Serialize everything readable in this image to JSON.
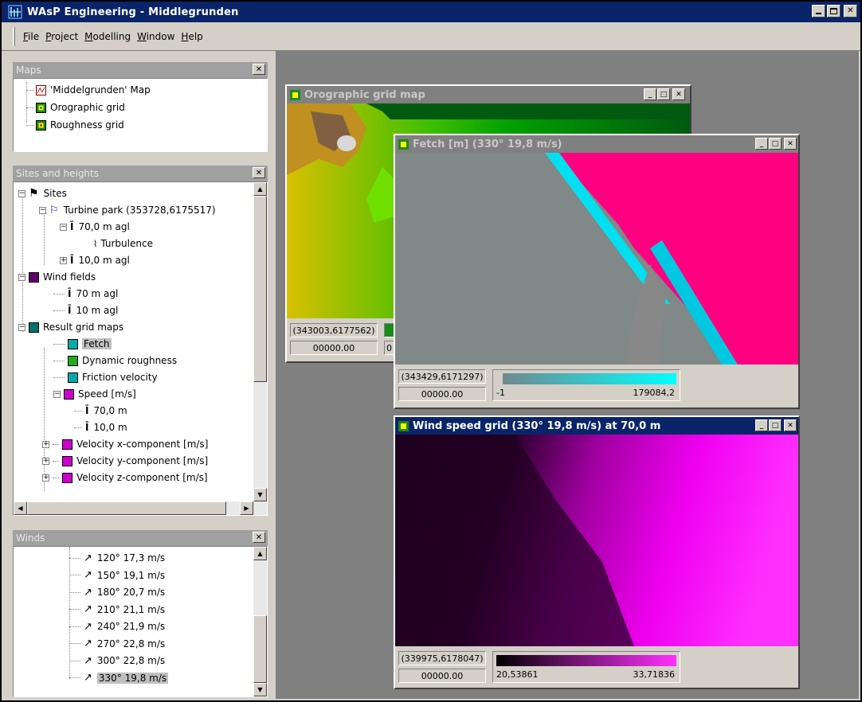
{
  "window": {
    "title": "WAsP Engineering - Middlegrunden"
  },
  "menu": [
    {
      "label": "File",
      "key": "F",
      "rest": "ile"
    },
    {
      "label": "Project",
      "key": "P",
      "rest": "roject"
    },
    {
      "label": "Modelling",
      "key": "M",
      "rest": "odelling"
    },
    {
      "label": "Window",
      "key": "W",
      "rest": "indow"
    },
    {
      "label": "Help",
      "key": "H",
      "rest": "elp"
    }
  ],
  "maps_panel": {
    "title": "Maps",
    "items": [
      "'Middelgrunden' Map",
      "Orographic grid",
      "Roughness grid"
    ]
  },
  "sites_panel": {
    "title": "Sites and heights",
    "sites": "Sites",
    "turbine_park": "Turbine park (353728,6175517)",
    "h70": "70,0 m agl",
    "turbulence": "Turbulence",
    "h10": "10,0 m agl",
    "wind_fields": "Wind fields",
    "wf70": "70 m agl",
    "wf10": "10 m agl",
    "result_grid_maps": "Result grid maps",
    "fetch": "Fetch",
    "dynamic_roughness": "Dynamic roughness",
    "friction_velocity": "Friction velocity",
    "speed": "Speed [m/s]",
    "speed70": "70,0 m",
    "speed10": "10,0 m",
    "vx": "Velocity x-component [m/s]",
    "vy": "Velocity y-component [m/s]",
    "vz": "Velocity z-component [m/s]"
  },
  "winds_panel": {
    "title": "Winds",
    "items": [
      "120° 17,3 m/s",
      "150° 19,1 m/s",
      "180° 20,7 m/s",
      "210° 21,1 m/s",
      "240° 21,9 m/s",
      "270° 22,8 m/s",
      "300° 22,8 m/s",
      "330° 19,8 m/s"
    ],
    "selected": "330° 19,8 m/s"
  },
  "orographic_window": {
    "title": "Orographic grid map",
    "coords": "(343003,6177562)",
    "value": "00000.00",
    "value2": "0"
  },
  "fetch_window": {
    "title": "Fetch [m] (330° 19,8 m/s)",
    "coords": "(343429,6171297)",
    "value": "00000.00",
    "legend_min": "-1",
    "legend_max": "179084,2"
  },
  "wind_window": {
    "title": "Wind speed grid  (330° 19,8 m/s) at 70,0 m",
    "coords": "(339975,6178047)",
    "value": "00000.00",
    "legend_min": "20,53861",
    "legend_max": "33,71836"
  }
}
